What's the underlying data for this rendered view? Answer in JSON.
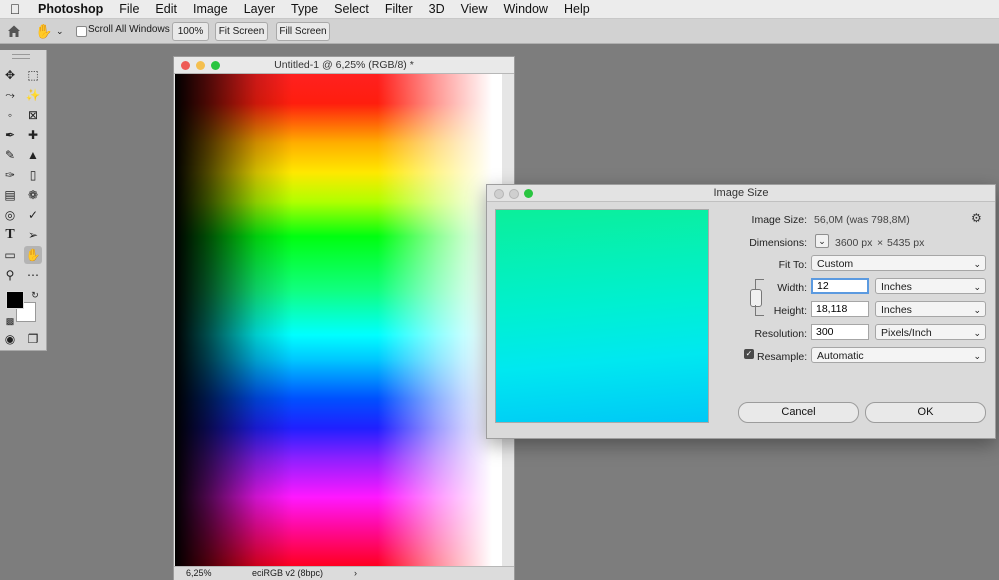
{
  "menubar": {
    "apple": "",
    "items": [
      "Photoshop",
      "File",
      "Edit",
      "Image",
      "Layer",
      "Type",
      "Select",
      "Filter",
      "3D",
      "View",
      "Window",
      "Help"
    ]
  },
  "options_bar": {
    "scroll_all_windows_label": "Scroll All Windows",
    "scroll_all_windows_checked": false,
    "btn_100": "100%",
    "btn_fit_screen": "Fit Screen",
    "btn_fill_screen": "Fill Screen"
  },
  "toolbox": {
    "tools": [
      "move",
      "marquee",
      "lasso",
      "magic-wand",
      "crop",
      "frame",
      "eyedropper",
      "healing",
      "brush",
      "stamp",
      "history-brush",
      "eraser",
      "gradient",
      "blur",
      "dodge",
      "pen",
      "type",
      "path-select",
      "rectangle",
      "hand",
      "zoom",
      "more"
    ],
    "active_tool": "hand",
    "foreground_color": "#000000",
    "background_color": "#ffffff"
  },
  "document": {
    "title": "Untitled-1 @ 6,25% (RGB/8) *",
    "zoom": "6,25%",
    "profile": "eciRGB v2 (8bpc)",
    "status_arrow": "›"
  },
  "dialog": {
    "title": "Image Size",
    "image_size_label": "Image Size:",
    "image_size_value": "56,0M (was 798,8M)",
    "dimensions_label": "Dimensions:",
    "dimensions_width": "3600 px",
    "dimensions_sep": "×",
    "dimensions_height": "5435 px",
    "fit_to_label": "Fit To:",
    "fit_to_value": "Custom",
    "width_label": "Width:",
    "width_value": "12",
    "width_unit": "Inches",
    "height_label": "Height:",
    "height_value": "18,118",
    "height_unit": "Inches",
    "resolution_label": "Resolution:",
    "resolution_value": "300",
    "resolution_unit": "Pixels/Inch",
    "resample_label": "Resample:",
    "resample_checked": true,
    "resample_value": "Automatic",
    "cancel_label": "Cancel",
    "ok_label": "OK"
  },
  "colors": {
    "traffic_close": "#ee5b56",
    "traffic_min": "#f4bf4f",
    "traffic_max": "#29c540",
    "focus_ring": "#5b9ae0"
  }
}
